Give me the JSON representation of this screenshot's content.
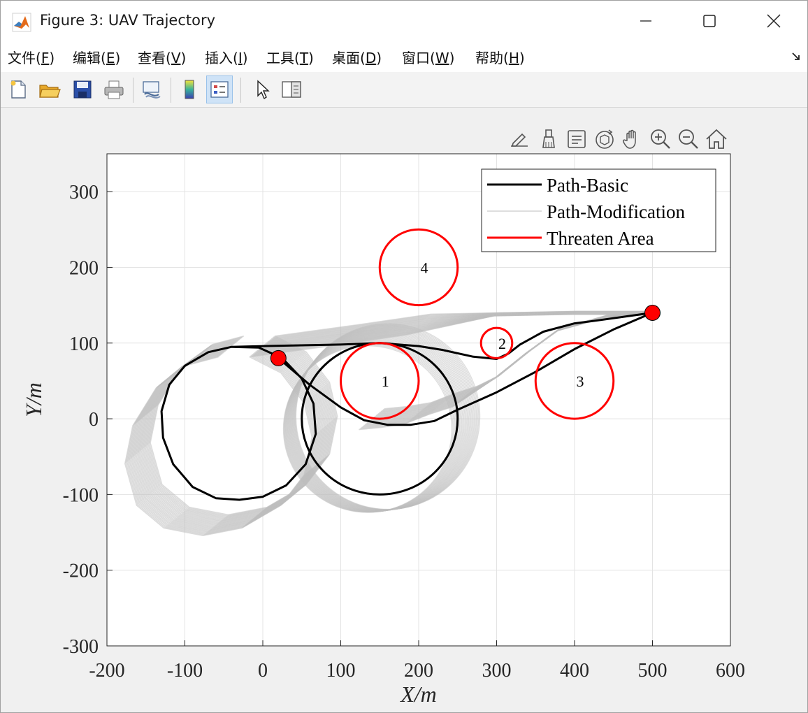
{
  "window": {
    "title": "Figure 3: UAV Trajectory"
  },
  "menu": [
    {
      "label": "文件(",
      "key": "F",
      "tail": ")"
    },
    {
      "label": "编辑(",
      "key": "E",
      "tail": ")"
    },
    {
      "label": "查看(",
      "key": "V",
      "tail": ")"
    },
    {
      "label": "插入(",
      "key": "I",
      "tail": ")"
    },
    {
      "label": "工具(",
      "key": "T",
      "tail": ")"
    },
    {
      "label": "桌面(",
      "key": "D",
      "tail": ")"
    },
    {
      "label": "窗口(",
      "key": "W",
      "tail": ")"
    },
    {
      "label": "帮助(",
      "key": "H",
      "tail": ")"
    }
  ],
  "toolbar_icons": [
    "new-figure-icon",
    "open-file-icon",
    "save-icon",
    "print-icon",
    "link-icon",
    "colorbar-icon",
    "legend-icon",
    "pointer-icon",
    "property-inspector-icon"
  ],
  "axes_toolbar_icons": [
    "edit-plot-icon",
    "brush-icon",
    "datatip-icon",
    "rotate-icon",
    "pan-icon",
    "zoom-in-icon",
    "zoom-out-icon",
    "home-icon"
  ],
  "colors": {
    "basic": "#000000",
    "modification": "#bdbdbd",
    "threat": "#ff0000",
    "endpoint": "#ff0000"
  },
  "chart_data": {
    "type": "line",
    "xlabel": "X/m",
    "ylabel": "Y/m",
    "xlim": [
      -200,
      600
    ],
    "ylim": [
      -300,
      350
    ],
    "xticks": [
      -200,
      -100,
      0,
      100,
      200,
      300,
      400,
      500,
      600
    ],
    "yticks": [
      -300,
      -200,
      -100,
      0,
      100,
      200,
      300
    ],
    "grid": true,
    "legend": {
      "position": "top-right",
      "entries": [
        "Path-Basic",
        "Path-Modification",
        "Threaten Area"
      ]
    },
    "threat_areas": [
      {
        "label": "1",
        "center": [
          150,
          50
        ],
        "radius": 50
      },
      {
        "label": "2",
        "center": [
          300,
          100
        ],
        "radius": 20
      },
      {
        "label": "3",
        "center": [
          400,
          50
        ],
        "radius": 50
      },
      {
        "label": "4",
        "center": [
          200,
          200
        ],
        "radius": 50
      }
    ],
    "endpoints": [
      [
        20,
        80
      ],
      [
        500,
        140
      ]
    ],
    "basic_path": [
      [
        20,
        80
      ],
      [
        60,
        45
      ],
      [
        100,
        15
      ],
      [
        130,
        -2
      ],
      [
        160,
        -8
      ],
      [
        190,
        -8
      ],
      [
        220,
        -3
      ],
      [
        250,
        12
      ],
      [
        300,
        35
      ],
      [
        350,
        62
      ],
      [
        400,
        92
      ],
      [
        450,
        118
      ],
      [
        500,
        140
      ],
      [
        430,
        130
      ],
      [
        400,
        126
      ],
      [
        360,
        115
      ],
      [
        330,
        98
      ],
      [
        315,
        86
      ],
      [
        300,
        79
      ],
      [
        270,
        82
      ],
      [
        230,
        91
      ],
      [
        200,
        96
      ],
      [
        150,
        100
      ],
      [
        100,
        98
      ],
      [
        0,
        96
      ],
      [
        -40,
        95
      ],
      [
        -70,
        88
      ],
      [
        -100,
        70
      ],
      [
        -120,
        45
      ],
      [
        -130,
        10
      ],
      [
        -128,
        -25
      ],
      [
        -115,
        -60
      ],
      [
        -90,
        -90
      ],
      [
        -60,
        -105
      ],
      [
        -30,
        -107
      ],
      [
        0,
        -103
      ],
      [
        30,
        -88
      ],
      [
        55,
        -60
      ],
      [
        68,
        -20
      ],
      [
        65,
        20
      ],
      [
        50,
        53
      ],
      [
        25,
        80
      ],
      [
        -5,
        94
      ],
      [
        -40,
        95
      ]
    ],
    "basic_loop_right": {
      "center": [
        150,
        0
      ],
      "rx": 100,
      "ry": 100
    },
    "modification_band": [
      [
        -40,
        96
      ],
      [
        -80,
        85
      ],
      [
        -120,
        55
      ],
      [
        -150,
        5
      ],
      [
        -160,
        -45
      ],
      [
        -145,
        -100
      ],
      [
        -110,
        -130
      ],
      [
        -60,
        -140
      ],
      [
        -10,
        -130
      ],
      [
        40,
        -100
      ],
      [
        70,
        -60
      ],
      [
        80,
        -10
      ],
      [
        70,
        35
      ],
      [
        40,
        75
      ],
      [
        0,
        96
      ],
      [
        100,
        110
      ],
      [
        200,
        125
      ],
      [
        300,
        138
      ],
      [
        400,
        140
      ],
      [
        500,
        140
      ],
      [
        440,
        135
      ],
      [
        380,
        118
      ],
      [
        340,
        88
      ],
      [
        300,
        55
      ],
      [
        260,
        30
      ],
      [
        230,
        20
      ],
      [
        200,
        8
      ],
      [
        170,
        3
      ],
      [
        140,
        0
      ]
    ],
    "modification_loop_right": {
      "center": [
        148,
        -5
      ],
      "rx": 108,
      "ry": 110
    }
  }
}
